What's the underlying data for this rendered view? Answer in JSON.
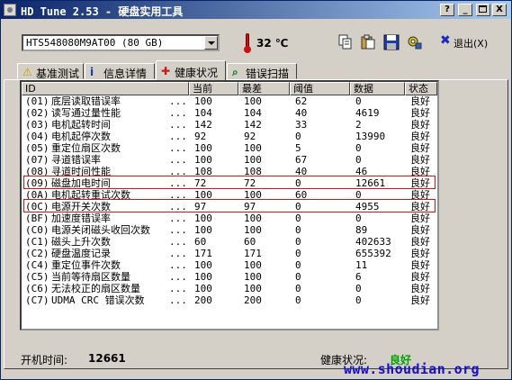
{
  "window": {
    "title": "HD Tune 2.53 - 硬盘实用工具",
    "btn_help": "?",
    "btn_minimize": "_",
    "btn_close": "X"
  },
  "toolbar": {
    "drive_select": "HTS548080M9AT00 (80 GB)",
    "temperature": "32 ℃",
    "exit_label": "退出(X)"
  },
  "tabs": [
    {
      "label": "基准测试",
      "icon": "?"
    },
    {
      "label": "信息详情",
      "icon": "i"
    },
    {
      "label": "健康状况",
      "icon": "✚"
    },
    {
      "label": "错误扫描",
      "icon": "⌕"
    }
  ],
  "table": {
    "columns": [
      "ID",
      "当前",
      "最差",
      "阈值",
      "数据",
      "状态"
    ],
    "rows": [
      {
        "id": "(01)",
        "name": "底层读取错误率",
        "dots": "...",
        "current": "100",
        "worst": "100",
        "threshold": "62",
        "data": "0",
        "status": "良好"
      },
      {
        "id": "(02)",
        "name": "读写通过量性能",
        "dots": "...",
        "current": "104",
        "worst": "104",
        "threshold": "40",
        "data": "4619",
        "status": "良好"
      },
      {
        "id": "(03)",
        "name": "电机起转时间",
        "dots": "...",
        "current": "142",
        "worst": "142",
        "threshold": "33",
        "data": "2",
        "status": "良好"
      },
      {
        "id": "(04)",
        "name": "电机起停次数",
        "dots": "...",
        "current": "92",
        "worst": "92",
        "threshold": "0",
        "data": "13990",
        "status": "良好"
      },
      {
        "id": "(05)",
        "name": "重定位扇区次数",
        "dots": "...",
        "current": "100",
        "worst": "100",
        "threshold": "5",
        "data": "0",
        "status": "良好"
      },
      {
        "id": "(07)",
        "name": "寻道错误率",
        "dots": "...",
        "current": "100",
        "worst": "100",
        "threshold": "67",
        "data": "0",
        "status": "良好"
      },
      {
        "id": "(08)",
        "name": "寻道时间性能",
        "dots": "...",
        "current": "108",
        "worst": "108",
        "threshold": "40",
        "data": "46",
        "status": "良好"
      },
      {
        "id": "(09)",
        "name": "磁盘加电时间",
        "dots": "...",
        "current": "72",
        "worst": "72",
        "threshold": "0",
        "data": "12661",
        "status": "良好"
      },
      {
        "id": "(0A)",
        "name": "电机起转重试次数",
        "dots": "...",
        "current": "100",
        "worst": "100",
        "threshold": "60",
        "data": "0",
        "status": "良好"
      },
      {
        "id": "(0C)",
        "name": "电源开关次数",
        "dots": "...",
        "current": "97",
        "worst": "97",
        "threshold": "0",
        "data": "4955",
        "status": "良好"
      },
      {
        "id": "(BF)",
        "name": "加速度错误率",
        "dots": "...",
        "current": "100",
        "worst": "100",
        "threshold": "0",
        "data": "0",
        "status": "良好"
      },
      {
        "id": "(C0)",
        "name": "电源关闭磁头收回次数",
        "dots": "...",
        "current": "100",
        "worst": "100",
        "threshold": "0",
        "data": "89",
        "status": "良好"
      },
      {
        "id": "(C1)",
        "name": "磁头上升次数",
        "dots": "...",
        "current": "60",
        "worst": "60",
        "threshold": "0",
        "data": "402633",
        "status": "良好"
      },
      {
        "id": "(C2)",
        "name": "硬盘温度记录",
        "dots": "...",
        "current": "171",
        "worst": "171",
        "threshold": "0",
        "data": "655392",
        "status": "良好"
      },
      {
        "id": "(C4)",
        "name": "重定位事件次数",
        "dots": "...",
        "current": "100",
        "worst": "100",
        "threshold": "0",
        "data": "11",
        "status": "良好"
      },
      {
        "id": "(C5)",
        "name": "当前等待扇区数量",
        "dots": "...",
        "current": "100",
        "worst": "100",
        "threshold": "0",
        "data": "6",
        "status": "良好"
      },
      {
        "id": "(C6)",
        "name": "无法校正的扇区数量",
        "dots": "...",
        "current": "100",
        "worst": "100",
        "threshold": "0",
        "data": "0",
        "status": "良好"
      },
      {
        "id": "(C7)",
        "name": "UDMA CRC 错误次数",
        "dots": "...",
        "current": "200",
        "worst": "200",
        "threshold": "0",
        "data": "0",
        "status": "良好"
      }
    ]
  },
  "footer": {
    "power_on_label": "开机时间:",
    "power_on_value": "12661",
    "health_label": "健康状况:",
    "health_value": "良好",
    "health_color": "#00a000"
  },
  "watermark": "www.shoudian.org",
  "colors": {
    "title_gradient_start": "#0a246a",
    "title_gradient_end": "#a6caf0",
    "highlight_box": "#d21414",
    "watermark": "#1810c8"
  }
}
